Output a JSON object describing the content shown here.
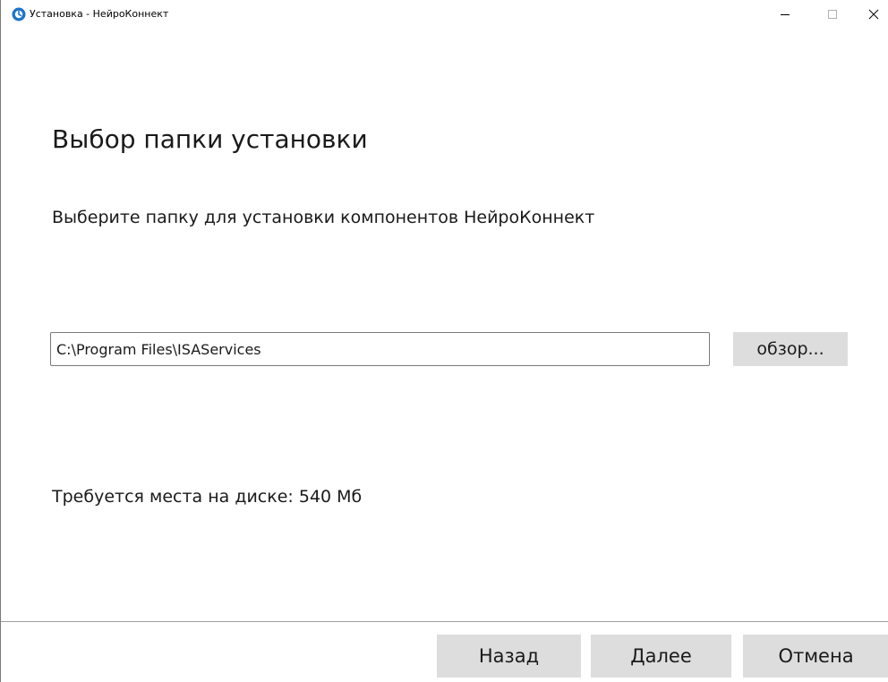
{
  "window": {
    "title": "Установка - НейроКоннект",
    "icon": "app-logo-icon",
    "controls": {
      "minimize": "minimize-icon",
      "maximize": "maximize-icon",
      "close": "close-icon"
    }
  },
  "page": {
    "heading": "Выбор папки установки",
    "subtitle": "Выберите папку для установки компонентов НейроКоннект"
  },
  "install_path": {
    "value": "C:\\Program Files\\ISAServices",
    "browse_label": "обзор..."
  },
  "disk": {
    "required_text": "Требуется места на диске: 540 Мб"
  },
  "footer": {
    "back_label": "Назад",
    "next_label": "Далее",
    "cancel_label": "Отмена"
  },
  "colors": {
    "button_bg": "#dddddd",
    "accent": "#1e73c8",
    "text": "#1a1a1a"
  }
}
